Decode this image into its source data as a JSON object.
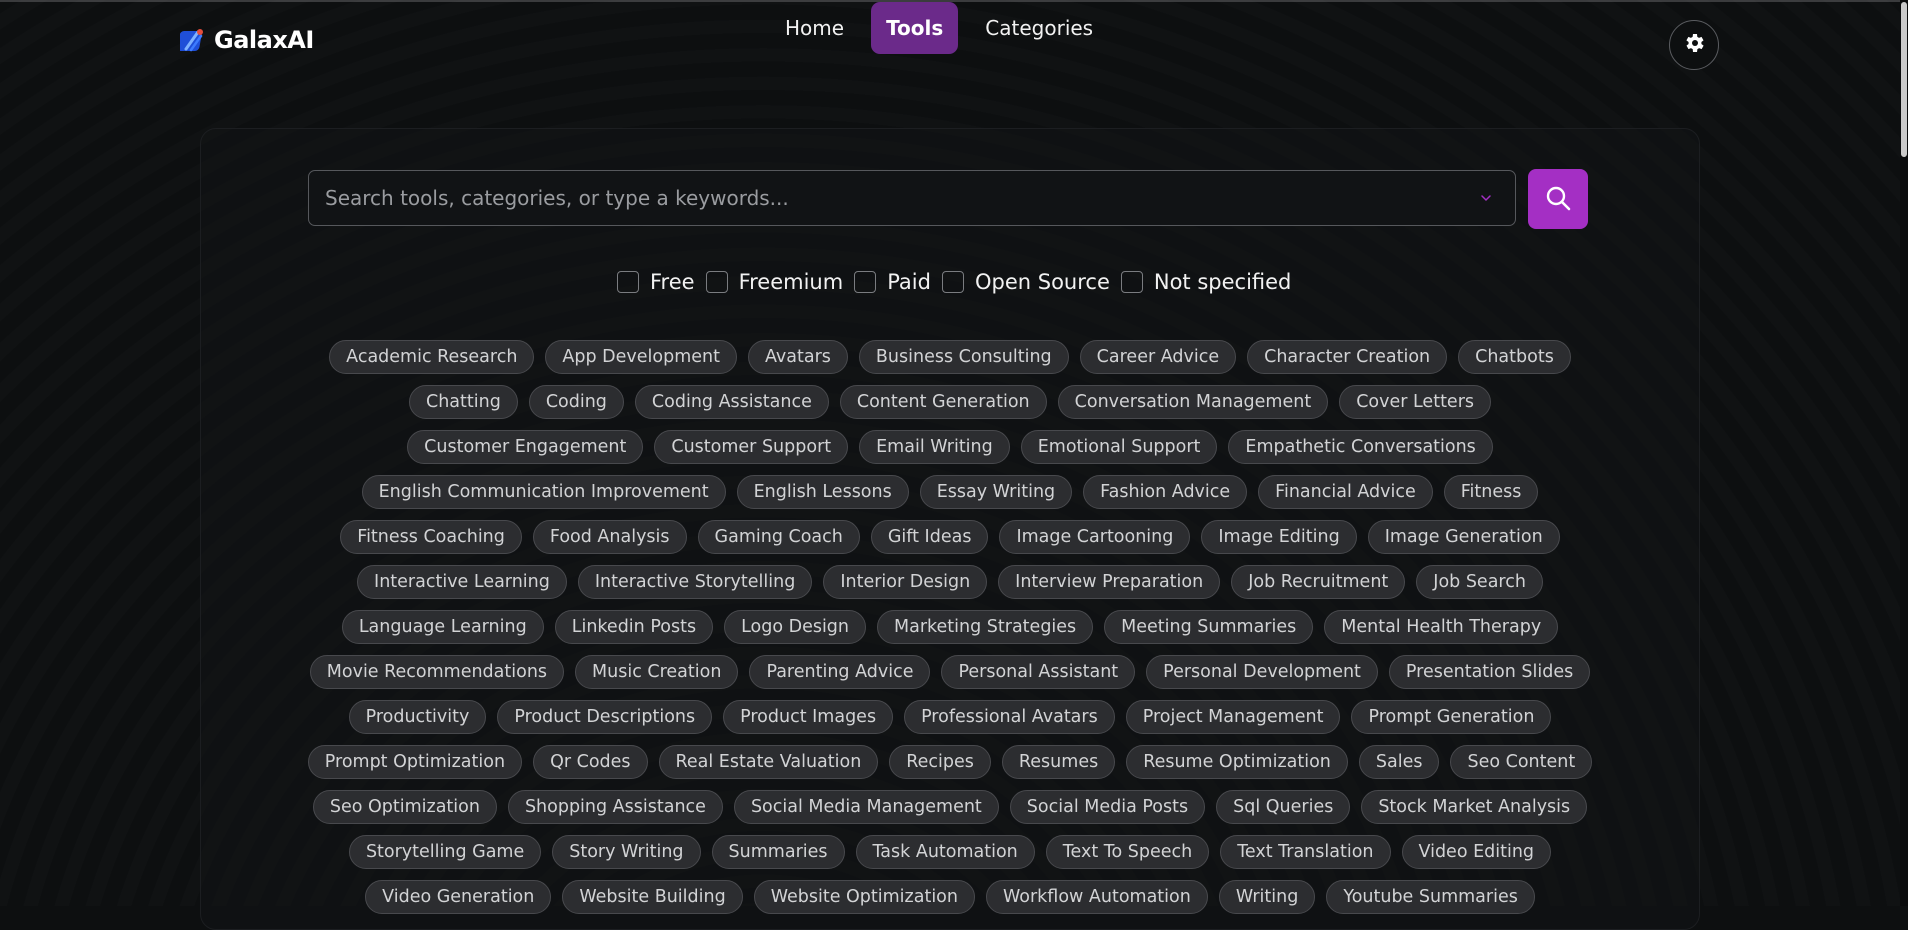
{
  "app": {
    "name": "GalaxAI"
  },
  "nav": {
    "items": [
      {
        "label": "Home",
        "active": false
      },
      {
        "label": "Tools",
        "active": true
      },
      {
        "label": "Categories",
        "active": false
      }
    ]
  },
  "search": {
    "value": "",
    "placeholder": "Search tools, categories, or type a keywords..."
  },
  "filters": [
    {
      "label": "Free",
      "checked": false
    },
    {
      "label": "Freemium",
      "checked": false
    },
    {
      "label": "Paid",
      "checked": false
    },
    {
      "label": "Open Source",
      "checked": false
    },
    {
      "label": "Not specified",
      "checked": false
    }
  ],
  "tag_rows": [
    [
      "Academic Research",
      "App Development",
      "Avatars",
      "Business Consulting",
      "Career Advice",
      "Character Creation",
      "Chatbots"
    ],
    [
      "Chatting",
      "Coding",
      "Coding Assistance",
      "Content Generation",
      "Conversation Management",
      "Cover Letters"
    ],
    [
      "Customer Engagement",
      "Customer Support",
      "Email Writing",
      "Emotional Support",
      "Empathetic Conversations"
    ],
    [
      "English Communication Improvement",
      "English Lessons",
      "Essay Writing",
      "Fashion Advice",
      "Financial Advice",
      "Fitness"
    ],
    [
      "Fitness Coaching",
      "Food Analysis",
      "Gaming Coach",
      "Gift Ideas",
      "Image Cartooning",
      "Image Editing",
      "Image Generation"
    ],
    [
      "Interactive Learning",
      "Interactive Storytelling",
      "Interior Design",
      "Interview Preparation",
      "Job Recruitment",
      "Job Search"
    ],
    [
      "Language Learning",
      "Linkedin Posts",
      "Logo Design",
      "Marketing Strategies",
      "Meeting Summaries",
      "Mental Health Therapy"
    ],
    [
      "Movie Recommendations",
      "Music Creation",
      "Parenting Advice",
      "Personal Assistant",
      "Personal Development",
      "Presentation Slides"
    ],
    [
      "Productivity",
      "Product Descriptions",
      "Product Images",
      "Professional Avatars",
      "Project Management",
      "Prompt Generation"
    ],
    [
      "Prompt Optimization",
      "Qr Codes",
      "Real Estate Valuation",
      "Recipes",
      "Resumes",
      "Resume Optimization",
      "Sales",
      "Seo Content"
    ],
    [
      "Seo Optimization",
      "Shopping Assistance",
      "Social Media Management",
      "Social Media Posts",
      "Sql Queries",
      "Stock Market Analysis"
    ],
    [
      "Storytelling Game",
      "Story Writing",
      "Summaries",
      "Task Automation",
      "Text To Speech",
      "Text Translation",
      "Video Editing"
    ],
    [
      "Video Generation",
      "Website Building",
      "Website Optimization",
      "Workflow Automation",
      "Writing",
      "Youtube Summaries"
    ]
  ],
  "colors": {
    "accent": "#a42fc4",
    "active_nav": "#6b2a8a",
    "background": "#0d0f10",
    "tag_bg": "#2c2d30"
  },
  "icons": {
    "logo": "galaxai-logo-icon",
    "settings": "gear-icon",
    "search": "search-icon",
    "dropdown": "chevron-down-icon"
  }
}
